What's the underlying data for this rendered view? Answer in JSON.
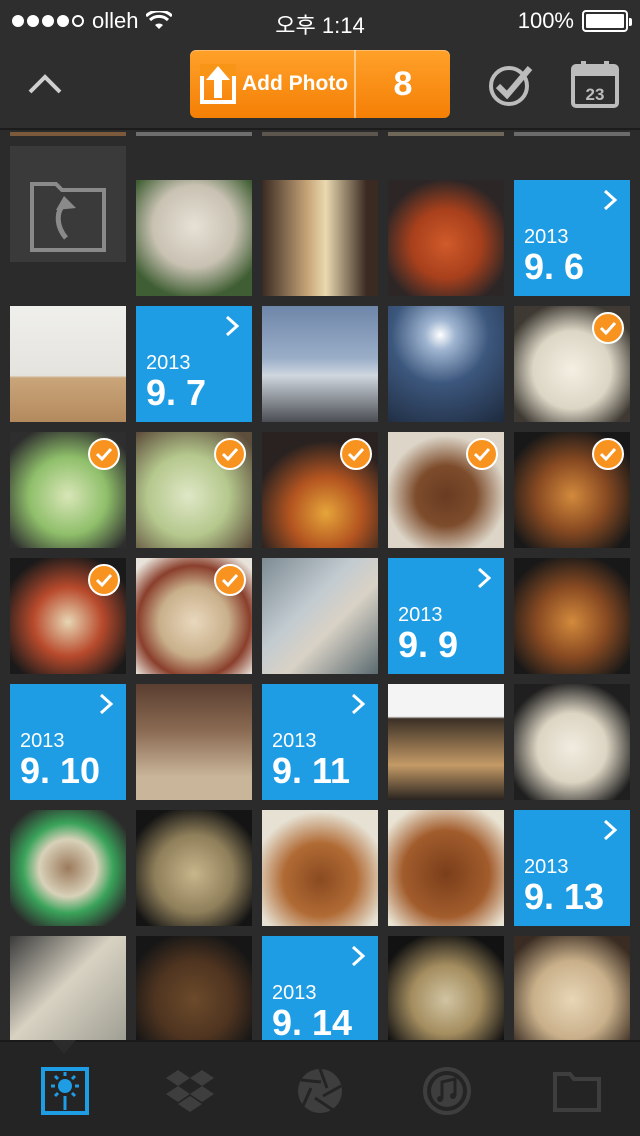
{
  "status": {
    "carrier": "olleh",
    "time": "오후 1:14",
    "battery": "100%"
  },
  "toolbar": {
    "add_photo_label": "Add Photo",
    "count": "8",
    "calendar_day": "23"
  },
  "colors": {
    "accent_orange": "#f7931e",
    "date_blue": "#1e9de5",
    "bar_bg": "#2e2e2e"
  },
  "dates": [
    {
      "year": "2013",
      "md": "9. 6"
    },
    {
      "year": "2013",
      "md": "9. 7"
    },
    {
      "year": "2013",
      "md": "9. 9"
    },
    {
      "year": "2013",
      "md": "9. 10"
    },
    {
      "year": "2013",
      "md": "9. 11"
    },
    {
      "year": "2013",
      "md": "9. 13"
    },
    {
      "year": "2013",
      "md": "9. 14"
    }
  ],
  "tabs": [
    "photos-tab",
    "dropbox-tab",
    "camera-tab",
    "music-tab",
    "files-tab"
  ]
}
